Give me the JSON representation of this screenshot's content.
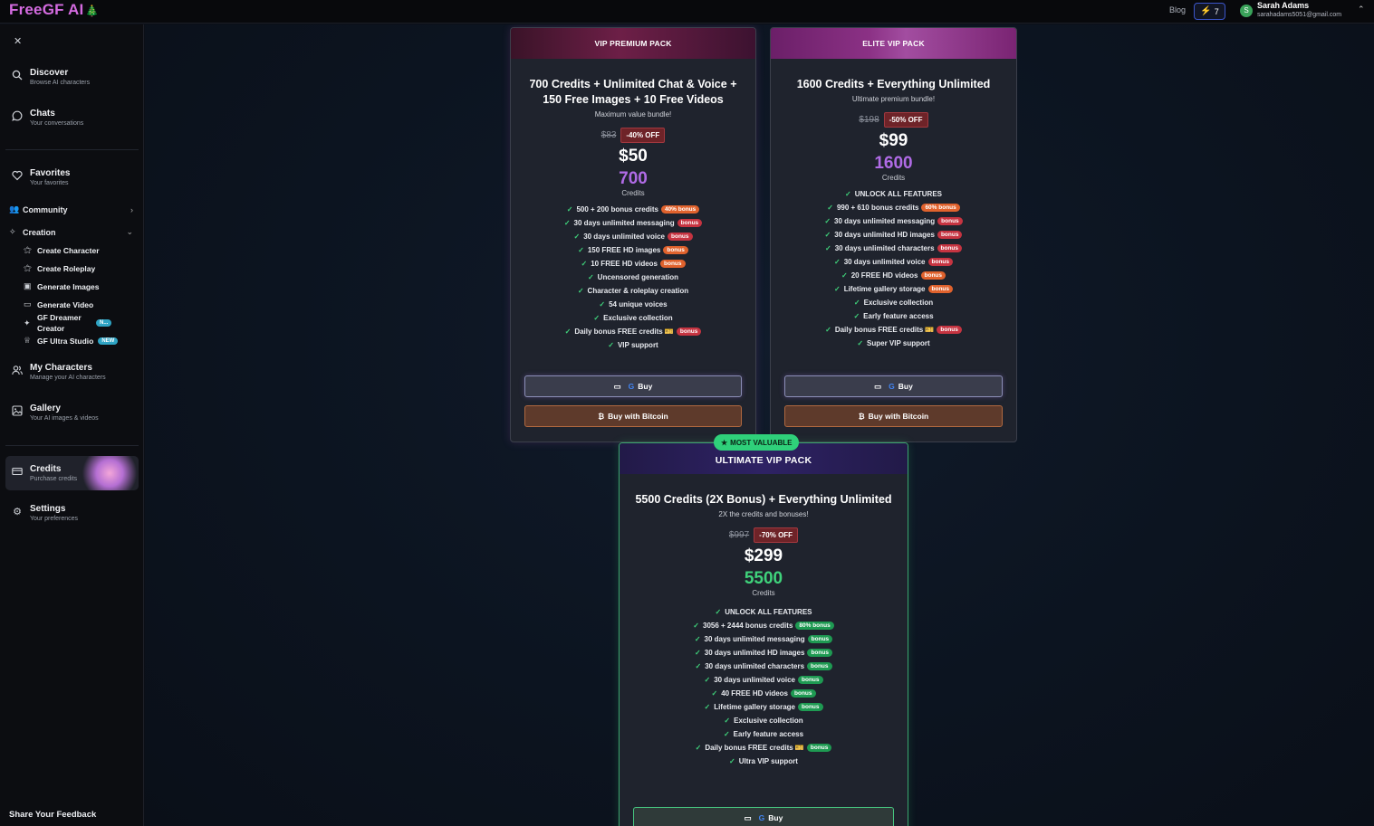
{
  "header": {
    "logo_text": "FreeGF AI",
    "logo_icon": "tree-icon",
    "blog_label": "Blog",
    "credit_count": "7",
    "user_initial": "S",
    "user_name": "Sarah Adams",
    "user_email": "sarahadams5051@gmail.com"
  },
  "sidebar": {
    "items": [
      {
        "title": "Discover",
        "subtitle": "Browse AI characters"
      },
      {
        "title": "Chats",
        "subtitle": "Your conversations"
      },
      {
        "title": "Favorites",
        "subtitle": "Your favorites"
      },
      {
        "title": "Community"
      },
      {
        "title": "Creation"
      },
      {
        "title": "My Characters",
        "subtitle": "Manage your AI characters"
      },
      {
        "title": "Gallery",
        "subtitle": "Your AI images & videos"
      },
      {
        "title": "Credits",
        "subtitle": "Purchase credits"
      },
      {
        "title": "Settings",
        "subtitle": "Your preferences"
      }
    ],
    "creation_sub": [
      {
        "label": "Create Character"
      },
      {
        "label": "Create Roleplay"
      },
      {
        "label": "Generate Images"
      },
      {
        "label": "Generate Video"
      },
      {
        "label": "GF Dreamer Creator",
        "badge": "N..."
      },
      {
        "label": "GF Ultra Studio",
        "badge": "NEW"
      }
    ],
    "feedback": "Share Your Feedback"
  },
  "cards": [
    {
      "banner": "VIP PREMIUM PACK",
      "headline": "700 Credits + Unlimited Chat & Voice + 150 Free Images + 10 Free Videos",
      "tagline": "Maximum value bundle!",
      "old_price": "$83",
      "discount": "-40% OFF",
      "price": "$50",
      "credits": "700",
      "credits_label": "Credits",
      "features": [
        {
          "text": "500 + 200 bonus credits",
          "badge": "40% bonus"
        },
        {
          "text": "30 days unlimited messaging",
          "badge": "bonus"
        },
        {
          "text": "30 days unlimited voice",
          "badge": "bonus"
        },
        {
          "text": "150 FREE HD images",
          "badge": "bonus"
        },
        {
          "text": "10 FREE HD videos",
          "badge": "bonus"
        },
        {
          "text": "Uncensored generation"
        },
        {
          "text": "Character & roleplay creation"
        },
        {
          "text": "54 unique voices"
        },
        {
          "text": "Exclusive collection"
        },
        {
          "text": "Daily bonus FREE credits 🎫",
          "badge": "bonus"
        },
        {
          "text": "VIP support"
        }
      ],
      "buy_label": "Buy",
      "btc_label": "Buy with Bitcoin"
    },
    {
      "banner": "ELITE VIP PACK",
      "headline": "1600 Credits + Everything Unlimited",
      "tagline": "Ultimate premium bundle!",
      "old_price": "$198",
      "discount": "-50% OFF",
      "price": "$99",
      "credits": "1600",
      "credits_label": "Credits",
      "features": [
        {
          "text": "UNLOCK ALL FEATURES"
        },
        {
          "text": "990 + 610 bonus credits",
          "badge": "60% bonus"
        },
        {
          "text": "30 days unlimited messaging",
          "badge": "bonus"
        },
        {
          "text": "30 days unlimited HD images",
          "badge": "bonus"
        },
        {
          "text": "30 days unlimited characters",
          "badge": "bonus"
        },
        {
          "text": "30 days unlimited voice",
          "badge": "bonus"
        },
        {
          "text": "20 FREE HD videos",
          "badge": "bonus"
        },
        {
          "text": "Lifetime gallery storage",
          "badge": "bonus"
        },
        {
          "text": "Exclusive collection"
        },
        {
          "text": "Early feature access"
        },
        {
          "text": "Daily bonus FREE credits 🎫",
          "badge": "bonus"
        },
        {
          "text": "Super VIP support"
        }
      ],
      "buy_label": "Buy",
      "btc_label": "Buy with Bitcoin"
    },
    {
      "ribbon": "MOST VALUABLE",
      "banner": "ULTIMATE VIP PACK",
      "headline": "5500 Credits (2X Bonus) + Everything Unlimited",
      "tagline": "2X the credits and bonuses!",
      "old_price": "$997",
      "discount": "-70% OFF",
      "price": "$299",
      "credits": "5500",
      "credits_label": "Credits",
      "features": [
        {
          "text": "UNLOCK ALL FEATURES"
        },
        {
          "text": "3056 + 2444 bonus credits",
          "badge": "80% bonus"
        },
        {
          "text": "30 days unlimited messaging",
          "badge": "bonus"
        },
        {
          "text": "30 days unlimited HD images",
          "badge": "bonus"
        },
        {
          "text": "30 days unlimited characters",
          "badge": "bonus"
        },
        {
          "text": "30 days unlimited voice",
          "badge": "bonus"
        },
        {
          "text": "40 FREE HD videos",
          "badge": "bonus"
        },
        {
          "text": "Lifetime gallery storage",
          "badge": "bonus"
        },
        {
          "text": "Exclusive collection"
        },
        {
          "text": "Early feature access"
        },
        {
          "text": "Daily bonus FREE credits 🎫",
          "badge": "bonus"
        },
        {
          "text": "Ultra VIP support"
        }
      ],
      "buy_label": "Buy"
    }
  ],
  "colors": {
    "accent_purple": "#b06be6",
    "accent_green": "#3fd37b",
    "badge_orange": "#e0622d",
    "badge_red": "#c63441",
    "badge_green": "#1e9a52"
  }
}
